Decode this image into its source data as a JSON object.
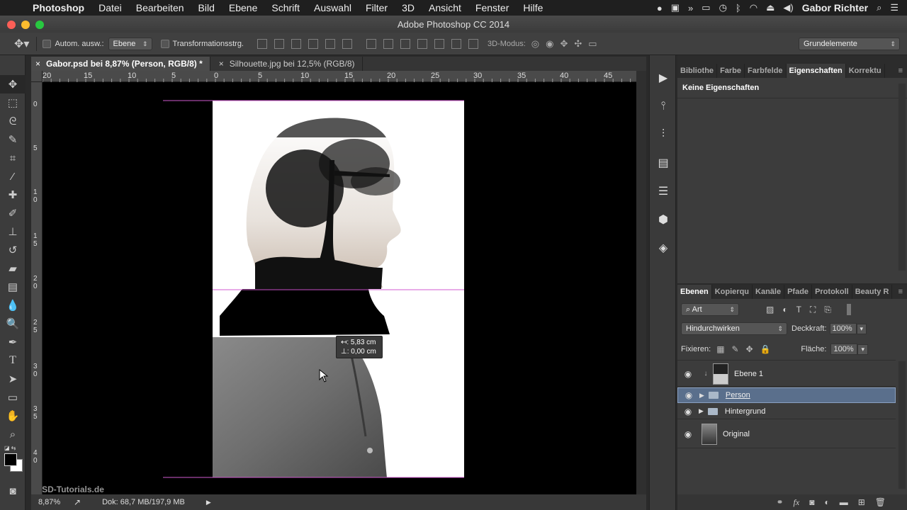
{
  "menubar": {
    "apple": "",
    "items": [
      "Photoshop",
      "Datei",
      "Bearbeiten",
      "Bild",
      "Ebene",
      "Schrift",
      "Auswahl",
      "Filter",
      "3D",
      "Ansicht",
      "Fenster",
      "Hilfe"
    ],
    "user": "Gabor Richter"
  },
  "window": {
    "title": "Adobe Photoshop CC 2014"
  },
  "options": {
    "auto_select_label": "Autom. ausw.:",
    "auto_select_value": "Ebene",
    "transform_label": "Transformationsstrg.",
    "mode3d_label": "3D-Modus:",
    "workspace_value": "Grundelemente"
  },
  "tabs": [
    {
      "label": "Gabor.psd bei 8,87% (Person, RGB/8) *",
      "close": "×"
    },
    {
      "label": "Silhouette.jpg bei 12,5% (RGB/8)",
      "close": "×"
    }
  ],
  "ruler": {
    "h_ticks": [
      "20",
      "15",
      "10",
      "5",
      "0",
      "5",
      "10",
      "15",
      "20",
      "25",
      "30",
      "35",
      "40",
      "45"
    ],
    "v_ticks": [
      "0",
      "5",
      "1\n0",
      "1\n5",
      "2\n0",
      "2\n5",
      "3\n0",
      "3\n5",
      "4\n0"
    ]
  },
  "measure_tooltip": {
    "dx": "↤: 5,83 cm",
    "dy": "⊥: 0,00 cm"
  },
  "status": {
    "zoom": "8,87%",
    "doc": "Dok: 68,7 MB/197,9 MB"
  },
  "watermark": "PSD-Tutorials.de",
  "panel_top": {
    "tabs": [
      "Bibliothe",
      "Farbe",
      "Farbfelde",
      "Eigenschaften",
      "Korrektu"
    ],
    "active_tab": "Eigenschaften",
    "content": "Keine Eigenschaften"
  },
  "layers_panel": {
    "tabs": [
      "Ebenen",
      "Kopierqu",
      "Kanäle",
      "Pfade",
      "Protokoll",
      "Beauty R"
    ],
    "filter_label": "Art",
    "blend_mode": "Hindurchwirken",
    "opacity_label": "Deckkraft:",
    "opacity_value": "100%",
    "lock_label": "Fixieren:",
    "fill_label": "Fläche:",
    "fill_value": "100%",
    "layers": [
      {
        "name": "Ebene 1",
        "type": "layer",
        "selected": false
      },
      {
        "name": "Person",
        "type": "group",
        "selected": true
      },
      {
        "name": "Hintergrund",
        "type": "group",
        "selected": false
      },
      {
        "name": "Original",
        "type": "layer",
        "selected": false
      }
    ]
  }
}
